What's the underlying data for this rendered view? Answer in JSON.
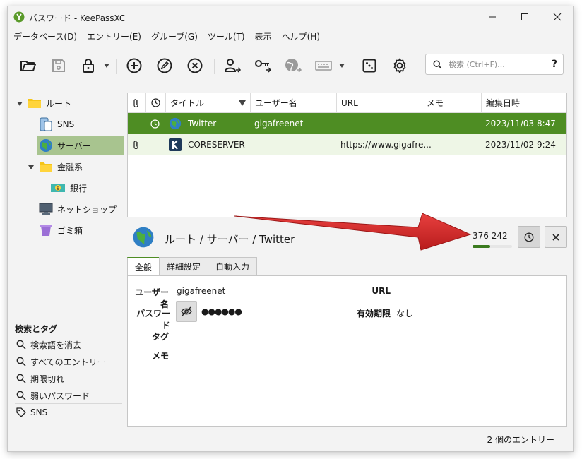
{
  "window": {
    "title": "パスワード - KeePassXC",
    "accent": "#4e8d23"
  },
  "menu": [
    "データベース(D)",
    "エントリー(E)",
    "グループ(G)",
    "ツール(T)",
    "表示",
    "ヘルプ(H)"
  ],
  "search": {
    "placeholder": "検索 (Ctrl+F)...",
    "help": "?"
  },
  "toolbar_icons": [
    "open-folder-icon",
    "save-icon",
    "lock-icon",
    "add-entry-icon",
    "edit-entry-icon",
    "delete-entry-icon",
    "copy-username-icon",
    "copy-password-icon",
    "copy-url-icon",
    "autotype-keyboard-icon",
    "password-generator-icon",
    "settings-gear-icon"
  ],
  "sidebar": {
    "groups": [
      {
        "label": "ルート",
        "icon": "folder-icon"
      },
      {
        "label": "SNS",
        "icon": "phone-icon"
      },
      {
        "label": "サーバー",
        "icon": "globe-icon"
      },
      {
        "label": "金融系",
        "icon": "folder-icon"
      },
      {
        "label": "銀行",
        "icon": "money-icon"
      },
      {
        "label": "ネットショップ",
        "icon": "monitor-icon"
      },
      {
        "label": "ゴミ箱",
        "icon": "trash-icon"
      }
    ],
    "tags_heading": "検索とタグ",
    "tags": [
      "検索語を消去",
      "すべてのエントリー",
      "期限切れ",
      "弱いパスワード"
    ],
    "user_tags": [
      "SNS"
    ]
  },
  "table": {
    "columns": [
      "タイトル",
      "ユーザー名",
      "URL",
      "メモ",
      "編集日時"
    ],
    "rows": [
      {
        "title": "Twitter",
        "username": "gigafreenet",
        "url": "",
        "notes": "",
        "modified": "2023/11/03 8:47"
      },
      {
        "title": "CORESERVER",
        "username": "",
        "url": "https://www.gigafre...",
        "notes": "",
        "modified": "2023/11/02 9:24"
      }
    ]
  },
  "detail": {
    "path": "ルート / サーバー / Twitter",
    "totp": "376 242",
    "totp_remaining_fraction": 0.45,
    "tabs": [
      "全般",
      "詳細設定",
      "自動入力"
    ],
    "fields": {
      "username_label": "ユーザー名",
      "username": "gigafreenet",
      "password_label": "パスワード",
      "password_mask": "●●●●●●",
      "url_label": "URL",
      "expiry_label": "有効期限",
      "expiry": "なし",
      "tags_label": "タグ",
      "notes_label": "メモ"
    }
  },
  "status": "2 個のエントリー"
}
